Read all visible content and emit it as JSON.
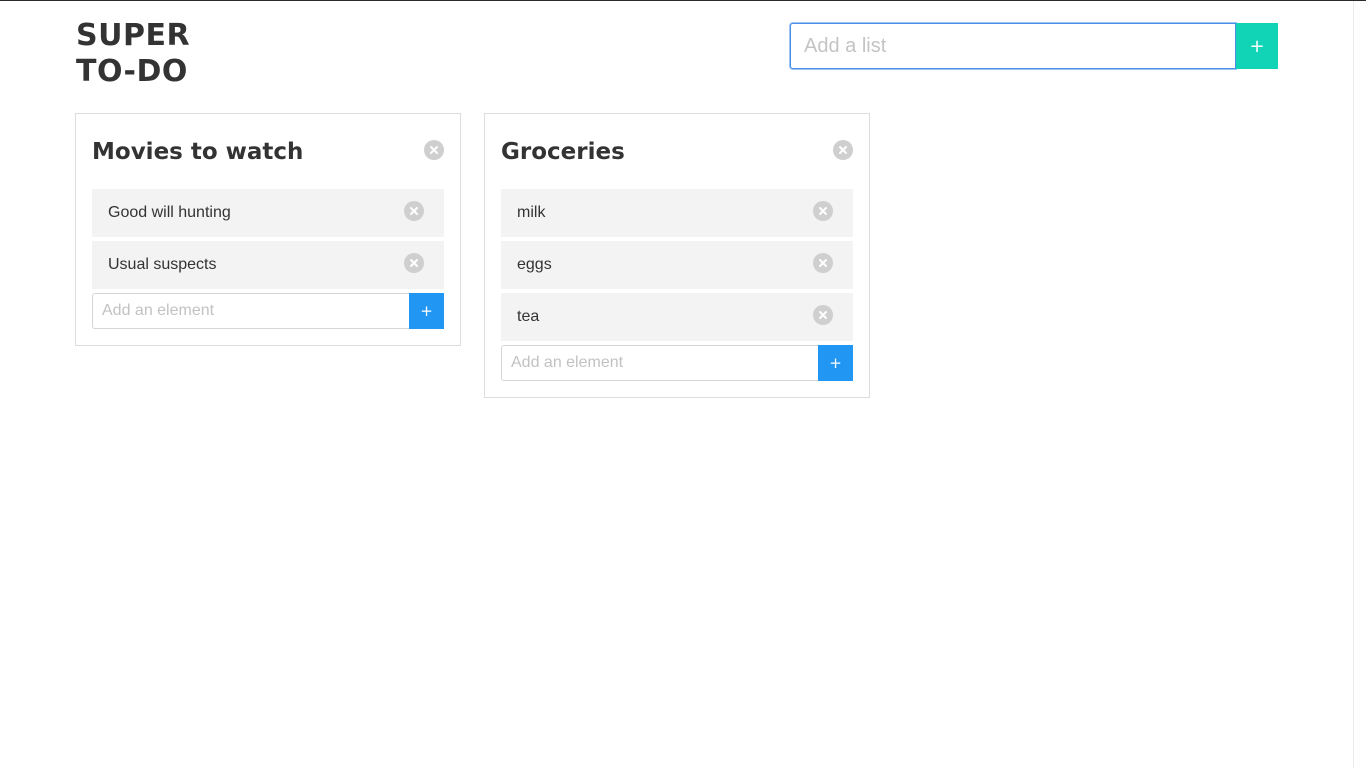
{
  "header": {
    "title_line1": "SUPER",
    "title_line2": "TO-DO"
  },
  "new_list": {
    "placeholder": "Add a list",
    "button_label": "+",
    "accent_color": "#11d3b6"
  },
  "lists": [
    {
      "title": "Movies to watch",
      "items": [
        "Good will hunting",
        "Usual suspects"
      ],
      "add_placeholder": "Add an element",
      "add_button_label": "+"
    },
    {
      "title": "Groceries",
      "items": [
        "milk",
        "eggs",
        "tea"
      ],
      "add_placeholder": "Add an element",
      "add_button_label": "+"
    }
  ],
  "icons": {
    "remove": "close-circle-icon"
  },
  "colors": {
    "add_button": "#2196f3",
    "remove_icon": "#cfcfcf",
    "item_background": "#f3f3f3"
  }
}
